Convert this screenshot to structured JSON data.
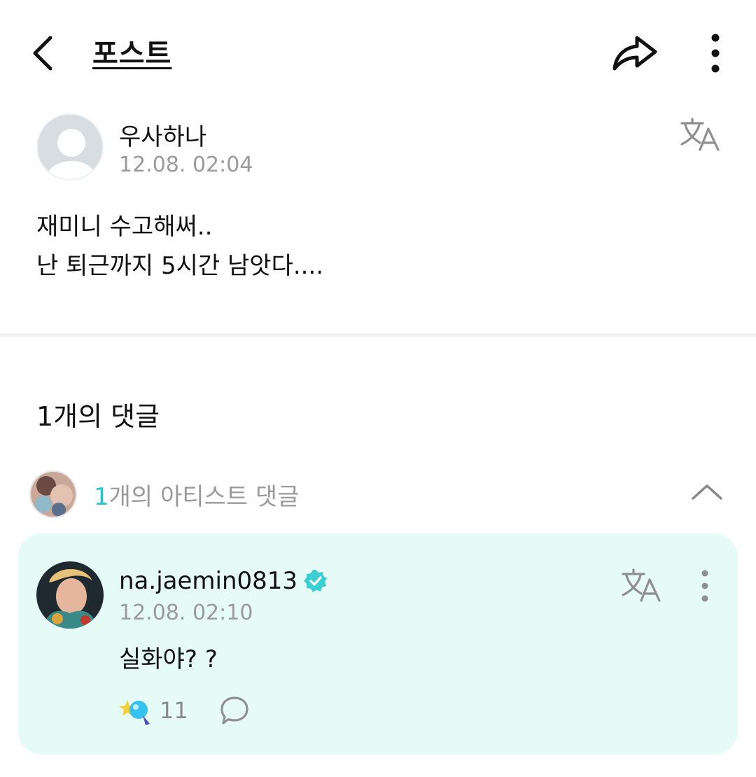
{
  "header": {
    "title": "포스트",
    "back_icon": "chevron-left-icon",
    "share_icon": "share-icon",
    "more_icon": "more-vertical-icon"
  },
  "post": {
    "author": "우사하나",
    "time": "12.08. 02:04",
    "body_line1": "재미니 수고해써..",
    "body_line2": "난 퇴근까지 5시간 남앗다...."
  },
  "comments": {
    "count_label": "1개의 댓글",
    "artist_count": "1",
    "artist_label": "개의 아티스트 댓글",
    "items": [
      {
        "username": "na.jaemin0813",
        "time": "12.08. 02:10",
        "text": "실화야? ?",
        "likes": "11"
      }
    ]
  },
  "colors": {
    "accent": "#2bc3c6",
    "card_bg": "#e7fbf6",
    "verified": "#3ccfd2",
    "muted": "#9a9a9a"
  }
}
